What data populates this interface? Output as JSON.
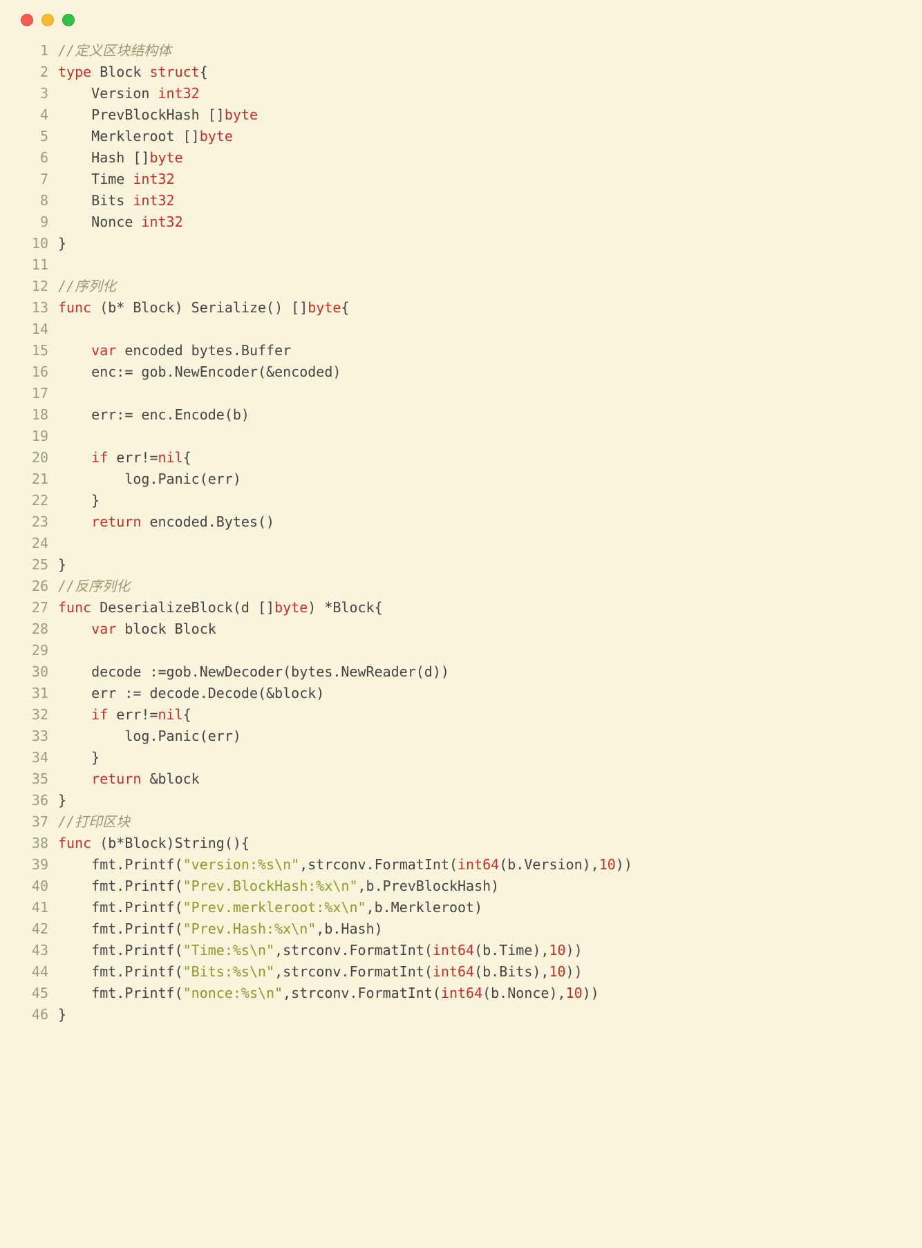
{
  "traffic_light_colors": {
    "red": "#f45d55",
    "yellow": "#f7bb2f",
    "green": "#30c146"
  },
  "lines": [
    {
      "n": 1,
      "tokens": [
        {
          "cls": "c",
          "t": "//定义区块结构体"
        }
      ]
    },
    {
      "n": 2,
      "tokens": [
        {
          "cls": "k",
          "t": "type"
        },
        {
          "cls": "id",
          "t": " Block "
        },
        {
          "cls": "k",
          "t": "struct"
        },
        {
          "cls": "id",
          "t": "{"
        }
      ]
    },
    {
      "n": 3,
      "tokens": [
        {
          "cls": "id",
          "t": "    Version "
        },
        {
          "cls": "t",
          "t": "int32"
        }
      ]
    },
    {
      "n": 4,
      "tokens": [
        {
          "cls": "id",
          "t": "    PrevBlockHash []"
        },
        {
          "cls": "t",
          "t": "byte"
        }
      ]
    },
    {
      "n": 5,
      "tokens": [
        {
          "cls": "id",
          "t": "    Merkleroot []"
        },
        {
          "cls": "t",
          "t": "byte"
        }
      ]
    },
    {
      "n": 6,
      "tokens": [
        {
          "cls": "id",
          "t": "    Hash []"
        },
        {
          "cls": "t",
          "t": "byte"
        }
      ]
    },
    {
      "n": 7,
      "tokens": [
        {
          "cls": "id",
          "t": "    Time "
        },
        {
          "cls": "t",
          "t": "int32"
        }
      ]
    },
    {
      "n": 8,
      "tokens": [
        {
          "cls": "id",
          "t": "    Bits "
        },
        {
          "cls": "t",
          "t": "int32"
        }
      ]
    },
    {
      "n": 9,
      "tokens": [
        {
          "cls": "id",
          "t": "    Nonce "
        },
        {
          "cls": "t",
          "t": "int32"
        }
      ]
    },
    {
      "n": 10,
      "tokens": [
        {
          "cls": "id",
          "t": "}"
        }
      ]
    },
    {
      "n": 11,
      "tokens": [
        {
          "cls": "id",
          "t": ""
        }
      ]
    },
    {
      "n": 12,
      "tokens": [
        {
          "cls": "c",
          "t": "//序列化"
        }
      ]
    },
    {
      "n": 13,
      "tokens": [
        {
          "cls": "k",
          "t": "func"
        },
        {
          "cls": "id",
          "t": " (b* Block) Serialize() []"
        },
        {
          "cls": "t",
          "t": "byte"
        },
        {
          "cls": "id",
          "t": "{"
        }
      ]
    },
    {
      "n": 14,
      "tokens": [
        {
          "cls": "id",
          "t": ""
        }
      ]
    },
    {
      "n": 15,
      "tokens": [
        {
          "cls": "id",
          "t": "    "
        },
        {
          "cls": "k",
          "t": "var"
        },
        {
          "cls": "id",
          "t": " encoded bytes.Buffer"
        }
      ]
    },
    {
      "n": 16,
      "tokens": [
        {
          "cls": "id",
          "t": "    enc:= gob.NewEncoder(&encoded)"
        }
      ]
    },
    {
      "n": 17,
      "tokens": [
        {
          "cls": "id",
          "t": ""
        }
      ]
    },
    {
      "n": 18,
      "tokens": [
        {
          "cls": "id",
          "t": "    err:= enc.Encode(b)"
        }
      ]
    },
    {
      "n": 19,
      "tokens": [
        {
          "cls": "id",
          "t": ""
        }
      ]
    },
    {
      "n": 20,
      "tokens": [
        {
          "cls": "id",
          "t": "    "
        },
        {
          "cls": "k",
          "t": "if"
        },
        {
          "cls": "id",
          "t": " err!="
        },
        {
          "cls": "nl",
          "t": "nil"
        },
        {
          "cls": "id",
          "t": "{"
        }
      ]
    },
    {
      "n": 21,
      "tokens": [
        {
          "cls": "id",
          "t": "        log.Panic(err)"
        }
      ]
    },
    {
      "n": 22,
      "tokens": [
        {
          "cls": "id",
          "t": "    }"
        }
      ]
    },
    {
      "n": 23,
      "tokens": [
        {
          "cls": "id",
          "t": "    "
        },
        {
          "cls": "k",
          "t": "return"
        },
        {
          "cls": "id",
          "t": " encoded.Bytes()"
        }
      ]
    },
    {
      "n": 24,
      "tokens": [
        {
          "cls": "id",
          "t": ""
        }
      ]
    },
    {
      "n": 25,
      "tokens": [
        {
          "cls": "id",
          "t": "}"
        }
      ]
    },
    {
      "n": 26,
      "tokens": [
        {
          "cls": "c",
          "t": "//反序列化"
        }
      ]
    },
    {
      "n": 27,
      "tokens": [
        {
          "cls": "k",
          "t": "func"
        },
        {
          "cls": "id",
          "t": " DeserializeBlock(d []"
        },
        {
          "cls": "t",
          "t": "byte"
        },
        {
          "cls": "id",
          "t": ") *Block{"
        }
      ]
    },
    {
      "n": 28,
      "tokens": [
        {
          "cls": "id",
          "t": "    "
        },
        {
          "cls": "k",
          "t": "var"
        },
        {
          "cls": "id",
          "t": " block Block"
        }
      ]
    },
    {
      "n": 29,
      "tokens": [
        {
          "cls": "id",
          "t": ""
        }
      ]
    },
    {
      "n": 30,
      "tokens": [
        {
          "cls": "id",
          "t": "    decode :=gob.NewDecoder(bytes.NewReader(d))"
        }
      ]
    },
    {
      "n": 31,
      "tokens": [
        {
          "cls": "id",
          "t": "    err := decode.Decode(&block)"
        }
      ]
    },
    {
      "n": 32,
      "tokens": [
        {
          "cls": "id",
          "t": "    "
        },
        {
          "cls": "k",
          "t": "if"
        },
        {
          "cls": "id",
          "t": " err!="
        },
        {
          "cls": "nl",
          "t": "nil"
        },
        {
          "cls": "id",
          "t": "{"
        }
      ]
    },
    {
      "n": 33,
      "tokens": [
        {
          "cls": "id",
          "t": "        log.Panic(err)"
        }
      ]
    },
    {
      "n": 34,
      "tokens": [
        {
          "cls": "id",
          "t": "    }"
        }
      ]
    },
    {
      "n": 35,
      "tokens": [
        {
          "cls": "id",
          "t": "    "
        },
        {
          "cls": "k",
          "t": "return"
        },
        {
          "cls": "id",
          "t": " &block"
        }
      ]
    },
    {
      "n": 36,
      "tokens": [
        {
          "cls": "id",
          "t": "}"
        }
      ]
    },
    {
      "n": 37,
      "tokens": [
        {
          "cls": "c",
          "t": "//打印区块"
        }
      ]
    },
    {
      "n": 38,
      "tokens": [
        {
          "cls": "k",
          "t": "func"
        },
        {
          "cls": "id",
          "t": " (b*Block)String(){"
        }
      ]
    },
    {
      "n": 39,
      "tokens": [
        {
          "cls": "id",
          "t": "    fmt.Printf("
        },
        {
          "cls": "s",
          "t": "\"version:%s\\n\""
        },
        {
          "cls": "id",
          "t": ",strconv.FormatInt("
        },
        {
          "cls": "t",
          "t": "int64"
        },
        {
          "cls": "id",
          "t": "(b.Version),"
        },
        {
          "cls": "n",
          "t": "10"
        },
        {
          "cls": "id",
          "t": "))"
        }
      ]
    },
    {
      "n": 40,
      "tokens": [
        {
          "cls": "id",
          "t": "    fmt.Printf("
        },
        {
          "cls": "s",
          "t": "\"Prev.BlockHash:%x\\n\""
        },
        {
          "cls": "id",
          "t": ",b.PrevBlockHash)"
        }
      ]
    },
    {
      "n": 41,
      "tokens": [
        {
          "cls": "id",
          "t": "    fmt.Printf("
        },
        {
          "cls": "s",
          "t": "\"Prev.merkleroot:%x\\n\""
        },
        {
          "cls": "id",
          "t": ",b.Merkleroot)"
        }
      ]
    },
    {
      "n": 42,
      "tokens": [
        {
          "cls": "id",
          "t": "    fmt.Printf("
        },
        {
          "cls": "s",
          "t": "\"Prev.Hash:%x\\n\""
        },
        {
          "cls": "id",
          "t": ",b.Hash)"
        }
      ]
    },
    {
      "n": 43,
      "tokens": [
        {
          "cls": "id",
          "t": "    fmt.Printf("
        },
        {
          "cls": "s",
          "t": "\"Time:%s\\n\""
        },
        {
          "cls": "id",
          "t": ",strconv.FormatInt("
        },
        {
          "cls": "t",
          "t": "int64"
        },
        {
          "cls": "id",
          "t": "(b.Time),"
        },
        {
          "cls": "n",
          "t": "10"
        },
        {
          "cls": "id",
          "t": "))"
        }
      ]
    },
    {
      "n": 44,
      "tokens": [
        {
          "cls": "id",
          "t": "    fmt.Printf("
        },
        {
          "cls": "s",
          "t": "\"Bits:%s\\n\""
        },
        {
          "cls": "id",
          "t": ",strconv.FormatInt("
        },
        {
          "cls": "t",
          "t": "int64"
        },
        {
          "cls": "id",
          "t": "(b.Bits),"
        },
        {
          "cls": "n",
          "t": "10"
        },
        {
          "cls": "id",
          "t": "))"
        }
      ]
    },
    {
      "n": 45,
      "tokens": [
        {
          "cls": "id",
          "t": "    fmt.Printf("
        },
        {
          "cls": "s",
          "t": "\"nonce:%s\\n\""
        },
        {
          "cls": "id",
          "t": ",strconv.FormatInt("
        },
        {
          "cls": "t",
          "t": "int64"
        },
        {
          "cls": "id",
          "t": "(b.Nonce),"
        },
        {
          "cls": "n",
          "t": "10"
        },
        {
          "cls": "id",
          "t": "))"
        }
      ]
    },
    {
      "n": 46,
      "tokens": [
        {
          "cls": "id",
          "t": "}"
        }
      ]
    }
  ]
}
